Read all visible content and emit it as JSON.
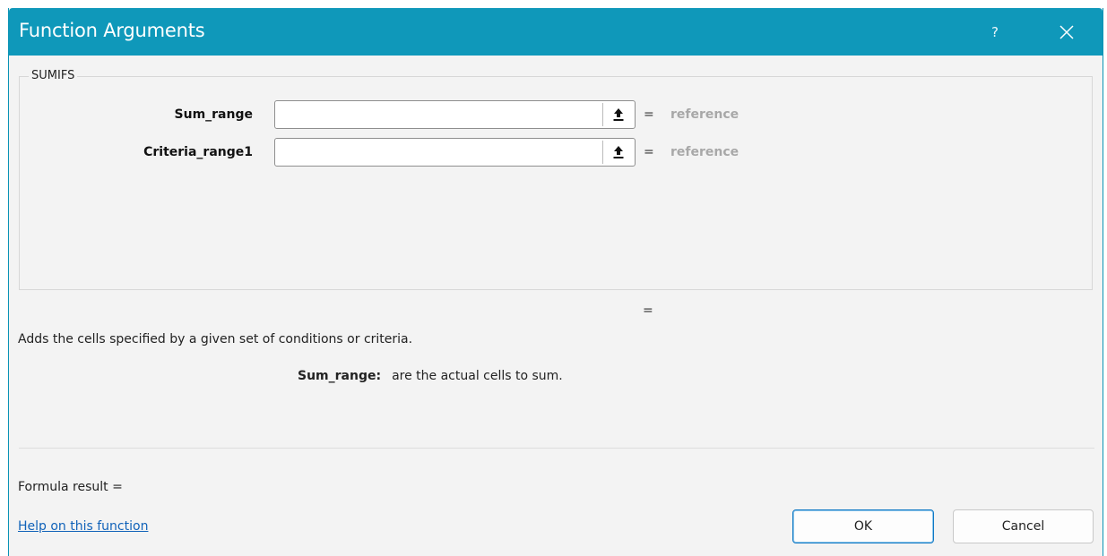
{
  "window": {
    "title": "Function Arguments",
    "help_glyph": "?",
    "close_icon": "close-icon",
    "accent_color": "#0f98ba"
  },
  "function_group": {
    "name": "SUMIFS",
    "arguments": [
      {
        "label": "Sum_range",
        "value": "",
        "equals": "=",
        "result": "reference",
        "icon": "collapse-dialog-icon"
      },
      {
        "label": "Criteria_range1",
        "value": "",
        "equals": "=",
        "result": "reference",
        "icon": "collapse-dialog-icon"
      }
    ]
  },
  "function_result_equals": "=",
  "description": "Adds the cells specified by a given set of conditions or criteria.",
  "argument_help": {
    "name": "Sum_range:",
    "text": "are the actual cells to sum."
  },
  "formula_result_label": "Formula result =",
  "help_link": "Help on this function",
  "buttons": {
    "ok": "OK",
    "cancel": "Cancel"
  }
}
